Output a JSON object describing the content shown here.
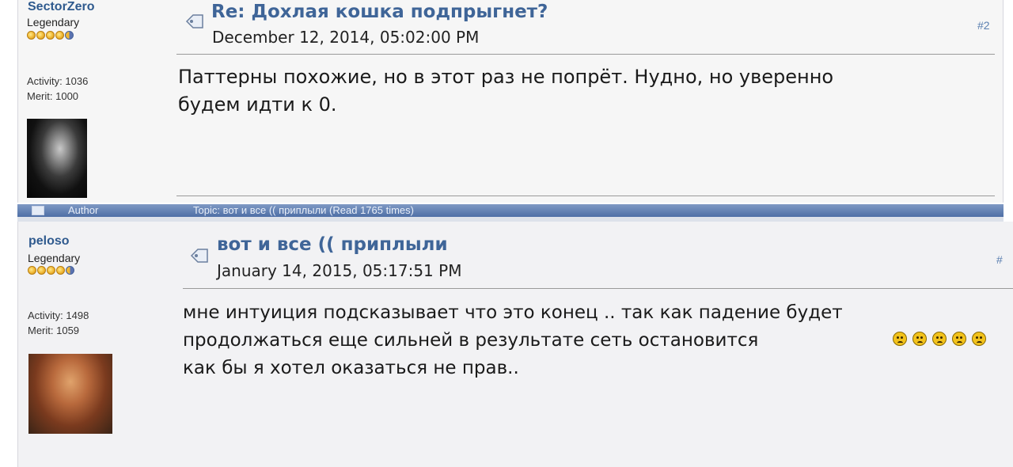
{
  "posts": [
    {
      "username": "SectorZero",
      "rank": "Legendary",
      "activity": "Activity: 1036",
      "merit": "Merit: 1000",
      "subject": "Re: Дохлая кошка подпрыгнет?",
      "date": "December 12, 2014, 05:02:00 PM",
      "post_number": "#2",
      "body_lines": [
        "Паттерны похожие, но в этот раз не попрёт. Нудно, но уверенно",
        "будем идти к 0."
      ]
    },
    {
      "username": "peloso",
      "rank": "Legendary",
      "activity": "Activity: 1498",
      "merit": "Merit: 1059",
      "subject": "вот и все (( приплыли",
      "date": "January 14, 2015, 05:17:51 PM",
      "post_number": "#",
      "body_lines": [
        "мне интуиция подсказывает что это конец .. так как падение будет",
        "продолжаться еще сильней в результате сеть остановится",
        "как бы я хотел оказаться не прав.."
      ]
    }
  ],
  "header_bar": {
    "author_label": "Author",
    "topic_label": "Topic: вот и все (( приплыли  (Read 1765 times)"
  },
  "icons": {
    "rank_star": "star-icon",
    "topic": "topic-icon",
    "smiley": "sad-smiley-icon"
  },
  "smiley_count": 5
}
